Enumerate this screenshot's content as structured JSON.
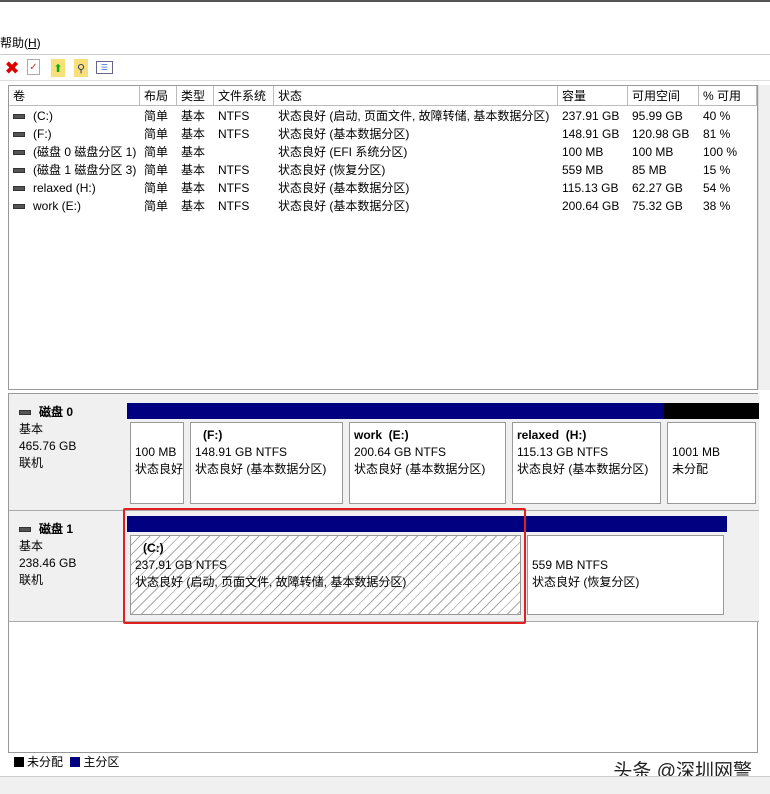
{
  "menu": {
    "help": "帮助(H)",
    "help_prefix": "帮助(",
    "help_key": "H",
    "help_suffix": ")"
  },
  "toolbar": {
    "icons": [
      "delete-icon",
      "properties-icon",
      "open-icon",
      "explore-icon",
      "settings-icon"
    ]
  },
  "table": {
    "headers": [
      "卷",
      "布局",
      "类型",
      "文件系统",
      "状态",
      "容量",
      "可用空间",
      "% 可用"
    ],
    "rows": [
      [
        "(C:)",
        "简单",
        "基本",
        "NTFS",
        "状态良好 (启动, 页面文件, 故障转储, 基本数据分区)",
        "237.91 GB",
        "95.99 GB",
        "40 %"
      ],
      [
        "(F:)",
        "简单",
        "基本",
        "NTFS",
        "状态良好 (基本数据分区)",
        "148.91 GB",
        "120.98 GB",
        "81 %"
      ],
      [
        "(磁盘 0 磁盘分区 1)",
        "简单",
        "基本",
        "",
        "状态良好 (EFI 系统分区)",
        "100 MB",
        "100 MB",
        "100 %"
      ],
      [
        "(磁盘 1 磁盘分区 3)",
        "简单",
        "基本",
        "NTFS",
        "状态良好 (恢复分区)",
        "559 MB",
        "85 MB",
        "15 %"
      ],
      [
        "relaxed (H:)",
        "简单",
        "基本",
        "NTFS",
        "状态良好 (基本数据分区)",
        "115.13 GB",
        "62.27 GB",
        "54 %"
      ],
      [
        "work (E:)",
        "简单",
        "基本",
        "NTFS",
        "状态良好 (基本数据分区)",
        "200.64 GB",
        "75.32 GB",
        "38 %"
      ]
    ]
  },
  "disks": [
    {
      "name": "磁盘 0",
      "type": "基本",
      "size": "465.76 GB",
      "status": "联机",
      "partitions": [
        {
          "title": "",
          "size": "100 MB",
          "status": "状态良好"
        },
        {
          "title": "(F:)",
          "size": "148.91 GB NTFS",
          "status": "状态良好 (基本数据分区)"
        },
        {
          "title": "work  (E:)",
          "size": "200.64 GB NTFS",
          "status": "状态良好 (基本数据分区)"
        },
        {
          "title": "relaxed  (H:)",
          "size": "115.13 GB NTFS",
          "status": "状态良好 (基本数据分区)"
        },
        {
          "title": "",
          "size": "1001 MB",
          "status": "未分配"
        }
      ]
    },
    {
      "name": "磁盘 1",
      "type": "基本",
      "size": "238.46 GB",
      "status": "联机",
      "partitions": [
        {
          "title": "(C:)",
          "size": "237.91 GB NTFS",
          "status": "状态良好 (启动, 页面文件, 故障转储, 基本数据分区)"
        },
        {
          "title": "",
          "size": "559 MB NTFS",
          "status": "状态良好 (恢复分区)"
        }
      ]
    }
  ],
  "legend": {
    "unallocated": "未分配",
    "primary": "主分区"
  },
  "colors": {
    "primary": "#000080",
    "unallocated": "#000000",
    "selection": "#e02020"
  },
  "watermark": "头条 @深圳网警"
}
